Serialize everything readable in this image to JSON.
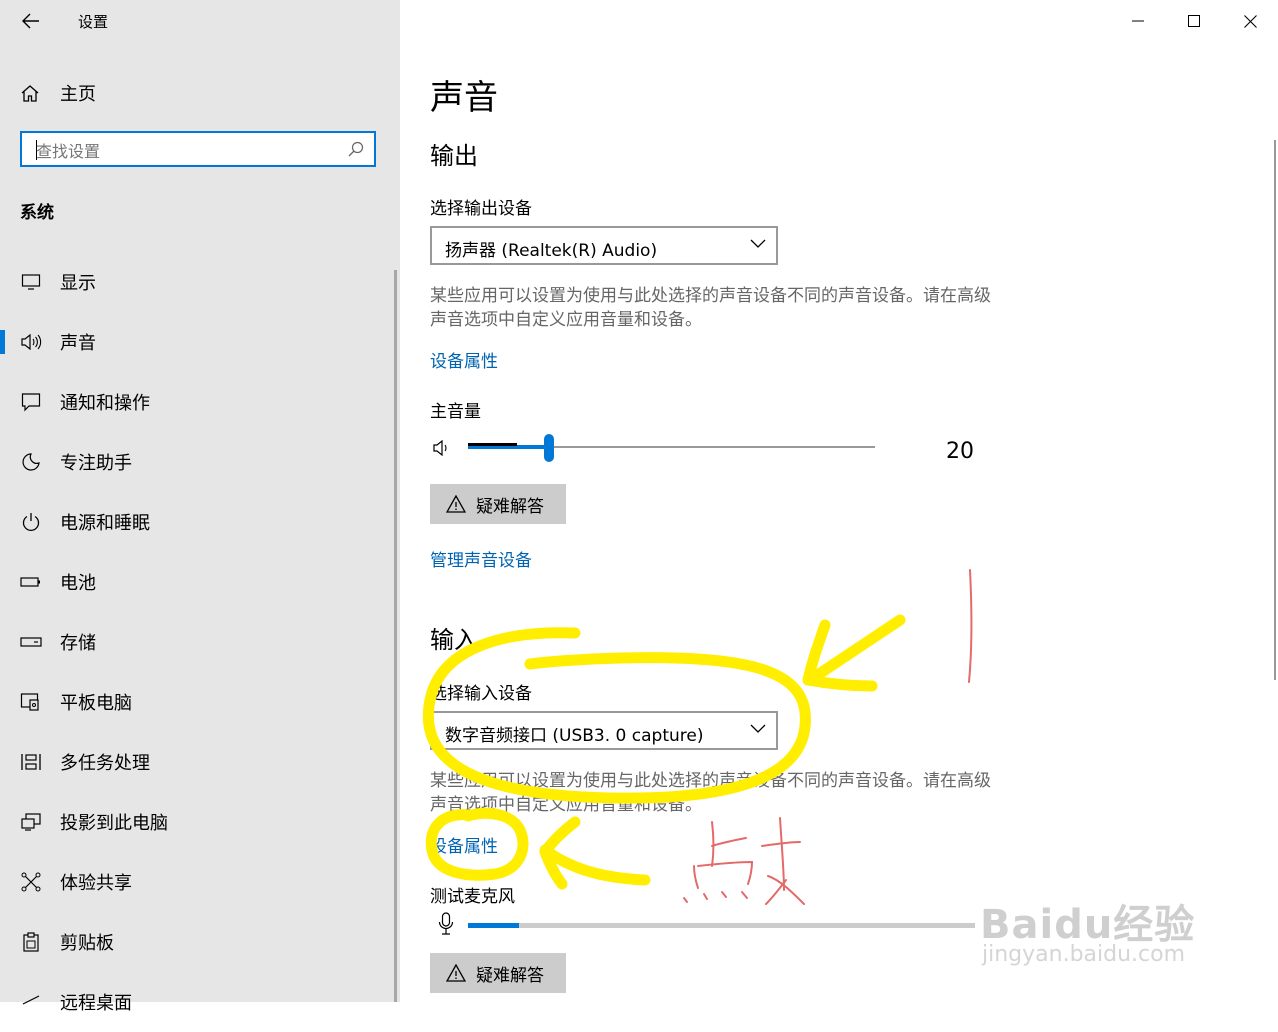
{
  "window": {
    "title": "设置"
  },
  "sidebar": {
    "home_label": "主页",
    "search_placeholder": "查找设置",
    "section_title": "系统",
    "items": [
      {
        "label": "显示",
        "icon": "display-icon"
      },
      {
        "label": "声音",
        "icon": "speaker-icon",
        "active": true
      },
      {
        "label": "通知和操作",
        "icon": "notification-icon"
      },
      {
        "label": "专注助手",
        "icon": "moon-icon"
      },
      {
        "label": "电源和睡眠",
        "icon": "power-icon"
      },
      {
        "label": "电池",
        "icon": "battery-icon"
      },
      {
        "label": "存储",
        "icon": "storage-icon"
      },
      {
        "label": "平板电脑",
        "icon": "tablet-icon"
      },
      {
        "label": "多任务处理",
        "icon": "multitask-icon"
      },
      {
        "label": "投影到此电脑",
        "icon": "project-icon"
      },
      {
        "label": "体验共享",
        "icon": "share-icon"
      },
      {
        "label": "剪贴板",
        "icon": "clipboard-icon"
      },
      {
        "label": "远程桌面",
        "icon": "remote-desktop-icon"
      }
    ]
  },
  "main": {
    "page_title": "声音",
    "output": {
      "heading": "输出",
      "select_label": "选择输出设备",
      "device": "扬声器 (Realtek(R) Audio)",
      "description": "某些应用可以设置为使用与此处选择的声音设备不同的声音设备。请在高级声音选项中自定义应用音量和设备。",
      "properties_link": "设备属性",
      "volume_label": "主音量",
      "volume_value": "20",
      "volume_level": 20,
      "peak_level": 12,
      "troubleshoot": "疑难解答",
      "manage_link": "管理声音设备"
    },
    "input": {
      "heading": "输入",
      "select_label": "选择输入设备",
      "device": "数字音频接口 (USB3. 0 capture)",
      "description": "某些应用可以设置为使用与此处选择的声音设备不同的声音设备。请在高级声音选项中自定义应用音量和设备。",
      "properties_link": "设备属性",
      "test_mic_label": "测试麦克风",
      "mic_level": 10,
      "troubleshoot": "疑难解答"
    }
  },
  "annotation": {
    "handwritten_text": "点击"
  },
  "watermark": {
    "line1": "Baidu经验",
    "line2": "jingyan.baidu.com"
  },
  "colors": {
    "accent": "#0078d7",
    "link": "#0063b1",
    "sidebar_bg": "#e6e6e6",
    "highlight": "#ffee00",
    "pen": "#e05050"
  }
}
